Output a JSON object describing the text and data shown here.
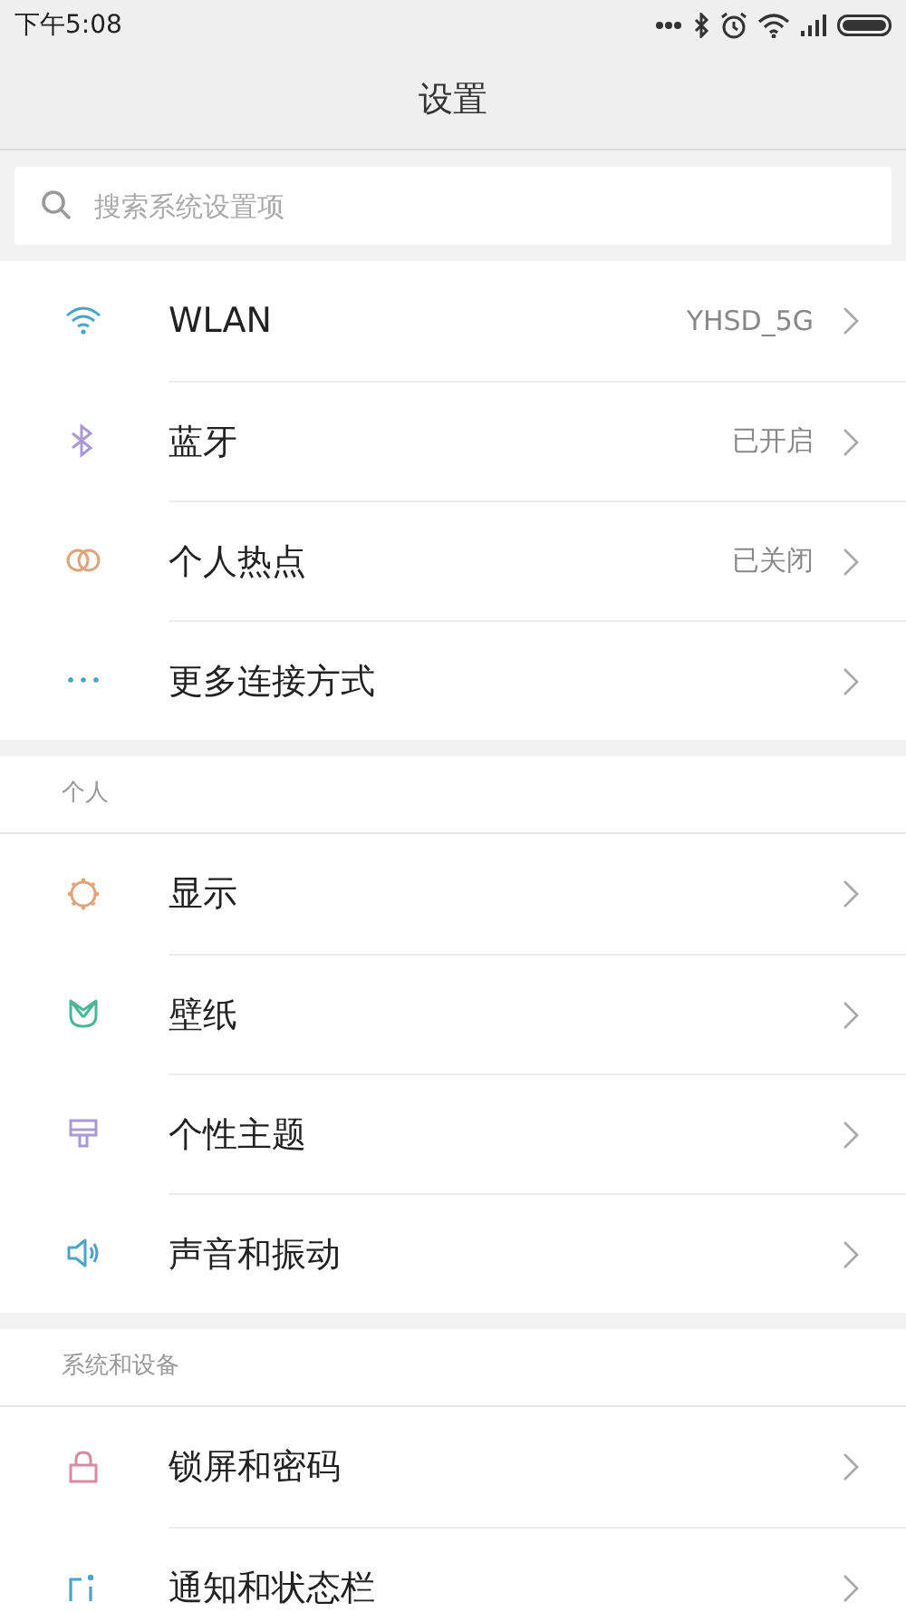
{
  "status_bar": {
    "time": "下午5:08"
  },
  "title": "设置",
  "search": {
    "placeholder": "搜索系统设置项"
  },
  "groups": [
    {
      "items": [
        {
          "label": "WLAN",
          "value": "YHSD_5G"
        },
        {
          "label": "蓝牙",
          "value": "已开启"
        },
        {
          "label": "个人热点",
          "value": "已关闭"
        },
        {
          "label": "更多连接方式"
        }
      ]
    },
    {
      "header": "个人",
      "items": [
        {
          "label": "显示"
        },
        {
          "label": "壁纸"
        },
        {
          "label": "个性主题"
        },
        {
          "label": "声音和振动"
        }
      ]
    },
    {
      "header": "系统和设备",
      "items": [
        {
          "label": "锁屏和密码"
        },
        {
          "label": "通知和状态栏"
        }
      ]
    }
  ]
}
